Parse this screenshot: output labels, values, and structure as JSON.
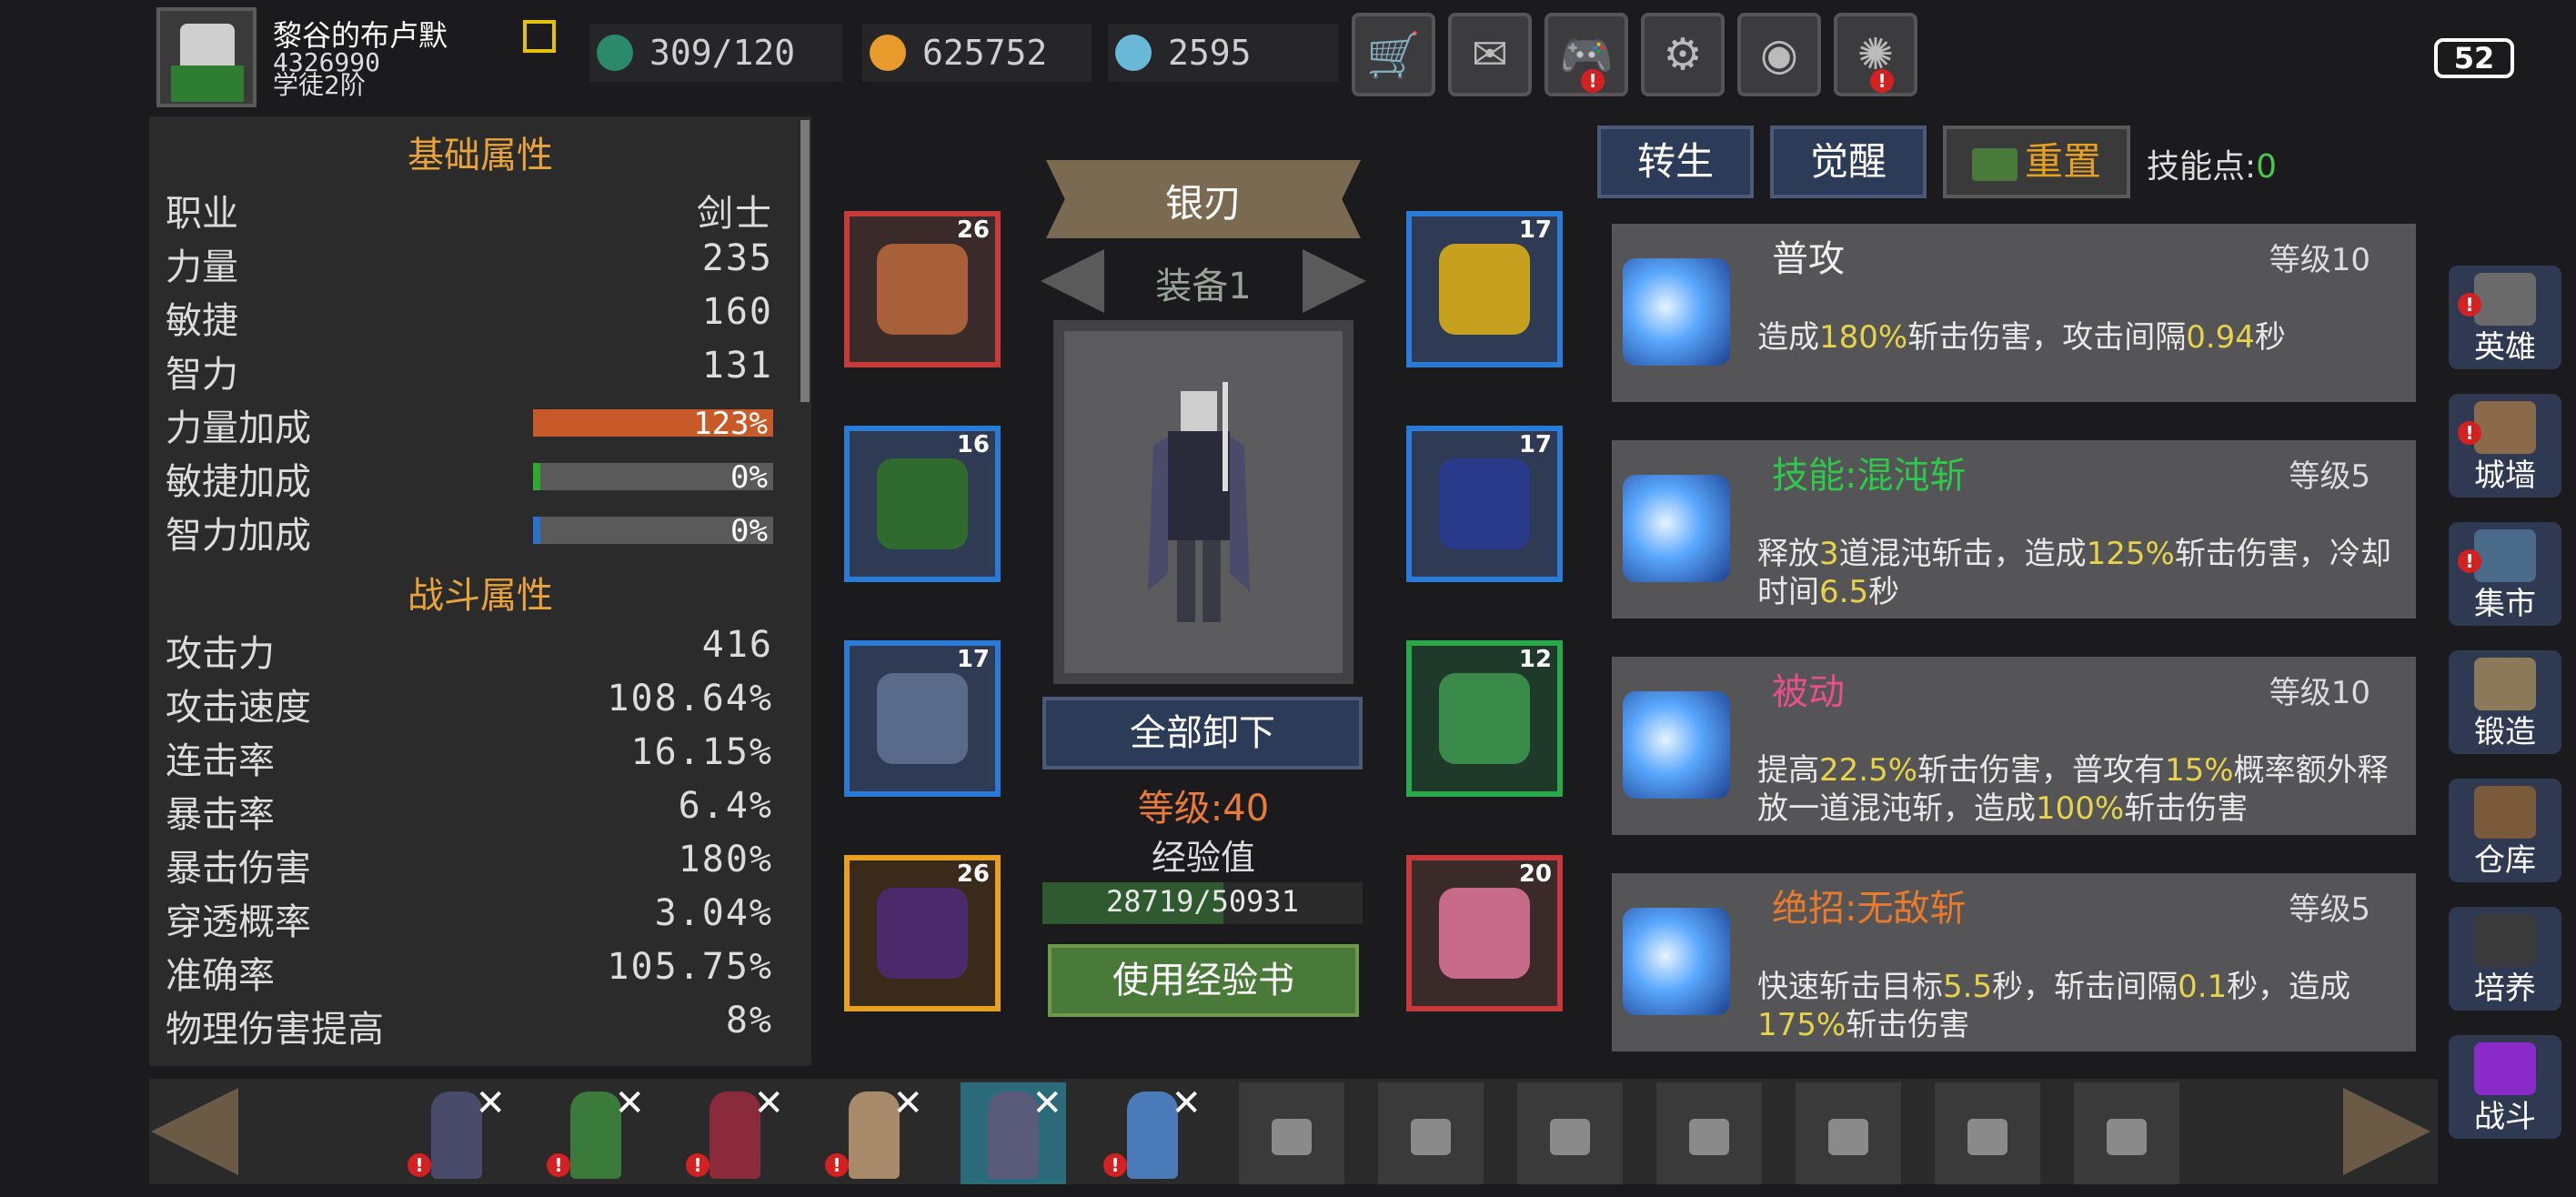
{
  "player": {
    "name": "黎谷的布卢默",
    "id": "4326990",
    "rank": "学徒2阶"
  },
  "resources": {
    "stamina": "309/120",
    "gold": "625752",
    "gems": "2595"
  },
  "top_buttons": [
    {
      "name": "shop",
      "icon": "🛒",
      "alert": false
    },
    {
      "name": "mail",
      "icon": "✉",
      "alert": false
    },
    {
      "name": "gamepad",
      "icon": "🎮",
      "alert": true
    },
    {
      "name": "settings",
      "icon": "⚙",
      "alert": false
    },
    {
      "name": "gacha",
      "icon": "◉",
      "alert": false
    },
    {
      "name": "fireworks",
      "icon": "✺",
      "alert": true
    }
  ],
  "battery": "52",
  "stats": {
    "basic_title": "基础属性",
    "basic": [
      {
        "label": "职业",
        "value": "剑士"
      },
      {
        "label": "力量",
        "value": "235"
      },
      {
        "label": "敏捷",
        "value": "160"
      },
      {
        "label": "智力",
        "value": "131"
      }
    ],
    "bonuses": [
      {
        "label": "力量加成",
        "value": "123%",
        "fill": 1.0,
        "color": "#c85a2a"
      },
      {
        "label": "敏捷加成",
        "value": "0%",
        "fill": 0.03,
        "color": "#2ea82e"
      },
      {
        "label": "智力加成",
        "value": "0%",
        "fill": 0.03,
        "color": "#2a72c8"
      }
    ],
    "combat_title": "战斗属性",
    "combat": [
      {
        "label": "攻击力",
        "value": "416"
      },
      {
        "label": "攻击速度",
        "value": "108.64%"
      },
      {
        "label": "连击率",
        "value": "16.15%"
      },
      {
        "label": "暴击率",
        "value": "6.4%"
      },
      {
        "label": "暴击伤害",
        "value": "180%"
      },
      {
        "label": "穿透概率",
        "value": "3.04%"
      },
      {
        "label": "准确率",
        "value": "105.75%"
      },
      {
        "label": "物理伤害提高",
        "value": "8%"
      }
    ]
  },
  "equipment": {
    "weapon_name": "银刃",
    "set_label": "装备1",
    "unequip_all": "全部卸下",
    "level_text": "等级:40",
    "exp_label": "经验值",
    "exp_text": "28719/50931",
    "exp_fraction": 0.564,
    "use_exp_book": "使用经验书",
    "slots_left": [
      {
        "level": "26",
        "border": "#c83a3a",
        "bg": "#3a2a2a",
        "art": "#a8603a"
      },
      {
        "level": "16",
        "border": "#2a7ad8",
        "bg": "#2f3a55",
        "art": "#2f6a2f"
      },
      {
        "level": "17",
        "border": "#2a7ad8",
        "bg": "#2f3a55",
        "art": "#5a6a8a"
      },
      {
        "level": "26",
        "border": "#e8a020",
        "bg": "#3a2a1a",
        "art": "#4a2a6a"
      }
    ],
    "slots_right": [
      {
        "level": "17",
        "border": "#2a7ad8",
        "bg": "#2f3a55",
        "art": "#c8a020"
      },
      {
        "level": "17",
        "border": "#2a7ad8",
        "bg": "#2f3a55",
        "art": "#2a3a8a"
      },
      {
        "level": "12",
        "border": "#2aa84a",
        "bg": "#1f3a2a",
        "art": "#3a8a4a"
      },
      {
        "level": "20",
        "border": "#c83a3a",
        "bg": "#3a2a2a",
        "art": "#c86a8a"
      }
    ]
  },
  "skill_tabs": {
    "rebirth": "转生",
    "awaken": "觉醒",
    "reset": "重置",
    "points_label": "技能点:",
    "points_value": "0"
  },
  "skills": [
    {
      "name": "普攻",
      "name_color": "#f0f0f0",
      "level": "等级10",
      "desc": [
        [
          "造成",
          ""
        ],
        [
          "180%",
          "hl"
        ],
        [
          "斩击伤害，攻击间隔",
          ""
        ],
        [
          "0.94",
          "hl"
        ],
        [
          "秒",
          ""
        ]
      ]
    },
    {
      "name": "技能:混沌斩",
      "name_color": "#2ec84a",
      "level": "等级5",
      "desc": [
        [
          "释放",
          ""
        ],
        [
          "3",
          "hl"
        ],
        [
          "道混沌斩击，造成",
          ""
        ],
        [
          "125%",
          "hl"
        ],
        [
          "斩击伤害，冷却时间",
          ""
        ],
        [
          "6.5",
          "hl"
        ],
        [
          "秒",
          ""
        ]
      ]
    },
    {
      "name": "被动",
      "name_color": "#e8508a",
      "level": "等级10",
      "desc": [
        [
          "提高",
          ""
        ],
        [
          "22.5%",
          "hl"
        ],
        [
          "斩击伤害，普攻有",
          ""
        ],
        [
          "15%",
          "hl"
        ],
        [
          "概率额外释放一道混沌斩，造成",
          ""
        ],
        [
          "100%",
          "hl"
        ],
        [
          "斩击伤害",
          ""
        ]
      ]
    },
    {
      "name": "绝招:无敌斩",
      "name_color": "#e87a2a",
      "level": "等级5",
      "desc": [
        [
          "快速斩击目标",
          ""
        ],
        [
          "5.5",
          "hl"
        ],
        [
          "秒，斩击间隔",
          ""
        ],
        [
          "0.1",
          "hl"
        ],
        [
          "秒，造成",
          ""
        ],
        [
          "175%",
          "hl"
        ],
        [
          "斩击伤害",
          ""
        ]
      ]
    }
  ],
  "side_nav": [
    {
      "label": "英雄",
      "alert": true,
      "color": "#6a6a6a"
    },
    {
      "label": "城墙",
      "alert": true,
      "color": "#8a6a4a"
    },
    {
      "label": "集市",
      "alert": true,
      "color": "#4a6a8a"
    },
    {
      "label": "锻造",
      "alert": false,
      "color": "#8a7a5a"
    },
    {
      "label": "仓库",
      "alert": false,
      "color": "#7a5a3a"
    },
    {
      "label": "培养",
      "alert": false,
      "color": "#3a3a3a"
    },
    {
      "label": "战斗",
      "alert": false,
      "color": "#8a2ac8"
    }
  ],
  "roster": [
    {
      "unlocked": true,
      "selected": false,
      "alert": true,
      "color": "#4a4a6a"
    },
    {
      "unlocked": true,
      "selected": false,
      "alert": true,
      "color": "#3a7a3a"
    },
    {
      "unlocked": true,
      "selected": false,
      "alert": true,
      "color": "#8a2a3a"
    },
    {
      "unlocked": true,
      "selected": false,
      "alert": true,
      "color": "#a88a6a"
    },
    {
      "unlocked": true,
      "selected": true,
      "alert": false,
      "color": "#5a5a7a"
    },
    {
      "unlocked": true,
      "selected": false,
      "alert": true,
      "color": "#4a7ab8"
    },
    {
      "unlocked": false
    },
    {
      "unlocked": false
    },
    {
      "unlocked": false
    },
    {
      "unlocked": false
    },
    {
      "unlocked": false
    },
    {
      "unlocked": false
    },
    {
      "unlocked": false
    }
  ]
}
